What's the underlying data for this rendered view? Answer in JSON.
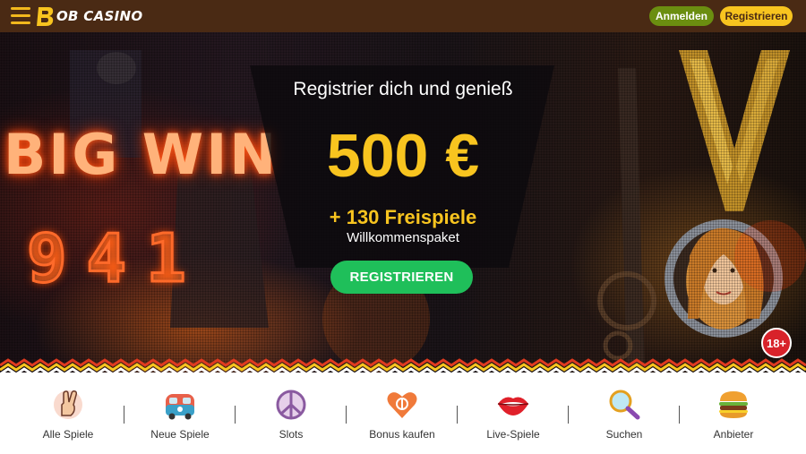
{
  "header": {
    "logo_text": "OB CASINO",
    "login_label": "Anmelden",
    "register_label": "Registrieren"
  },
  "hero": {
    "slot_text_1": "BIG WIN",
    "slot_text_2": "941",
    "promo_title": "Registrier dich und genieß",
    "promo_amount": "500 €",
    "promo_spins": "+ 130 Freispiele",
    "promo_package": "Willkommenspaket",
    "cta_label": "REGISTRIEREN",
    "age_badge": "18+"
  },
  "categories": [
    {
      "label": "Alle Spiele",
      "icon": "peace-hand-icon"
    },
    {
      "label": "Neue Spiele",
      "icon": "hippie-van-icon"
    },
    {
      "label": "Slots",
      "icon": "peace-sign-icon"
    },
    {
      "label": "Bonus kaufen",
      "icon": "heart-icon"
    },
    {
      "label": "Live-Spiele",
      "icon": "lips-icon"
    },
    {
      "label": "Suchen",
      "icon": "magnifier-icon"
    },
    {
      "label": "Anbieter",
      "icon": "burger-icon"
    }
  ],
  "colors": {
    "header_bg": "#4a2a14",
    "accent_yellow": "#f8c41f",
    "login_green": "#6b8e10",
    "cta_green": "#1fbf5a",
    "badge_red": "#d8222a"
  }
}
